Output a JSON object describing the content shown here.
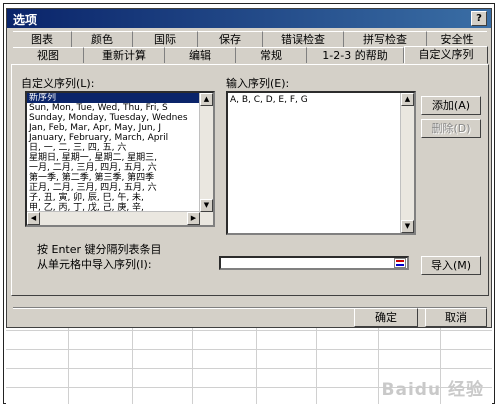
{
  "dialog": {
    "title": "选项",
    "help_label": "?"
  },
  "tabs_row1": [
    "图表",
    "颜色",
    "国际",
    "保存",
    "错误检查",
    "拼写检查",
    "安全性"
  ],
  "tabs_row2": [
    "视图",
    "重新计算",
    "编辑",
    "常规",
    "1-2-3 的帮助",
    "自定义序列"
  ],
  "custom_lists": {
    "label": "自定义序列(L):",
    "items": [
      "新序列",
      "Sun, Mon, Tue, Wed, Thu, Fri, S",
      "Sunday, Monday, Tuesday, Wednes",
      "Jan, Feb, Mar, Apr, May, Jun, J",
      "January, February, March, April",
      "日, 一, 二, 三, 四, 五, 六",
      "星期日, 星期一, 星期二, 星期三,",
      "一月, 二月, 三月, 四月, 五月, 六",
      "第一季, 第二季, 第三季, 第四季",
      "正月, 二月, 三月, 四月, 五月, 六",
      "子, 丑, 寅, 卯, 辰, 巳, 午, 未,",
      "甲, 乙, 丙, 丁, 戊, 己, 庚, 辛,"
    ],
    "selected_index": 0
  },
  "entries": {
    "label": "输入序列(E):",
    "value": "A, B, C, D, E, F, G"
  },
  "buttons": {
    "add": "添加(A)",
    "delete": "删除(D)",
    "import": "导入(M)",
    "ok": "确定",
    "cancel": "取消"
  },
  "hint": "按 Enter 键分隔列表条目",
  "import_label": "从单元格中导入序列(I):",
  "watermark": "Baidu 经验"
}
